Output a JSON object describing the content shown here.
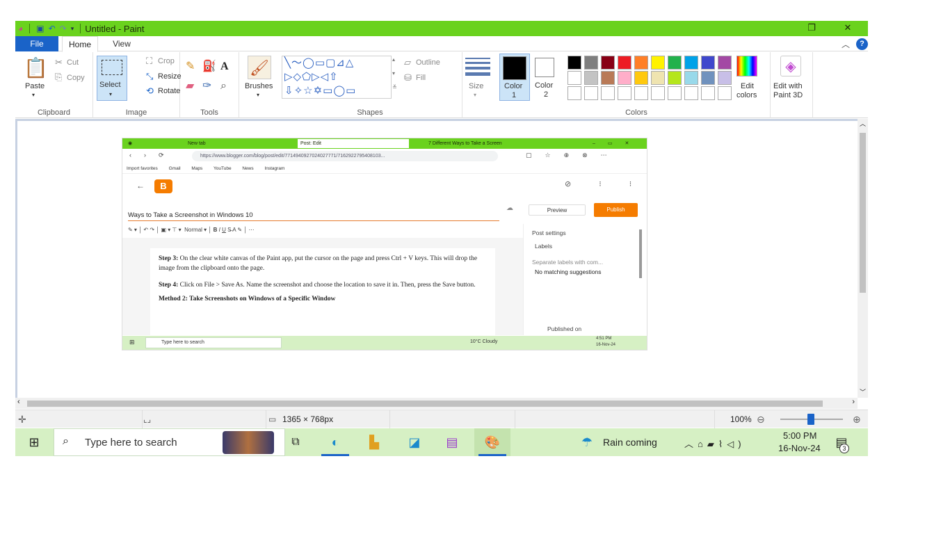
{
  "window": {
    "title": "Untitled - Paint",
    "restore_icon": "restore-icon",
    "close_glyph": "✕",
    "restore_glyph": "❐"
  },
  "tabs": {
    "file": "File",
    "home": "Home",
    "view": "View"
  },
  "ribbon": {
    "clipboard": {
      "group_label": "Clipboard",
      "paste": "Paste",
      "cut": "Cut",
      "copy": "Copy"
    },
    "image": {
      "group_label": "Image",
      "select": "Select",
      "crop": "Crop",
      "resize": "Resize",
      "rotate": "Rotate"
    },
    "tools": {
      "group_label": "Tools"
    },
    "brushes": "Brushes",
    "shapes": {
      "group_label": "Shapes",
      "outline": "Outline",
      "fill": "Fill",
      "glyphs": "╲〜◯▭▢⊿△\n▷◇⬠▷◁⇧\n⇩✧☆✡▭◯▭"
    },
    "size": "Size",
    "colors": {
      "group_label": "Colors",
      "color1": "Color",
      "color1_num": "1",
      "color2": "Color",
      "color2_num": "2",
      "edit_colors": "Edit",
      "edit_colors_2": "colors",
      "edit_3d": "Edit with",
      "edit_3d_2": "Paint 3D",
      "row1": [
        "#000000",
        "#7f7f7f",
        "#880015",
        "#ed1c24",
        "#ff7f27",
        "#fff200",
        "#22b14c",
        "#00a2e8",
        "#3f48cc",
        "#a349a4"
      ],
      "row2": [
        "#ffffff",
        "#c3c3c3",
        "#b97a57",
        "#ffaec9",
        "#ffc90e",
        "#efe4b0",
        "#b5e61d",
        "#99d9ea",
        "#7092be",
        "#c8bfe7"
      ],
      "color1_value": "#000000",
      "color2_value": "#ffffff"
    }
  },
  "status": {
    "canvas_size": "1365 × 768px",
    "zoom": "100%"
  },
  "taskbar": {
    "search_placeholder": "Type here to search",
    "weather": "Rain coming",
    "time": "5:00 PM",
    "date": "16-Nov-24",
    "notifications": "3"
  },
  "screenshot": {
    "tabs": [
      "New tab",
      "Post: Edit",
      "7 Different Ways to Take a Screen"
    ],
    "url": "https://www.blogger.com/blog/post/edit/7714940927024027771/7162922795408103...",
    "bookmarks": [
      "Import favorites",
      "Gmail",
      "Maps",
      "YouTube",
      "News",
      "Instagram"
    ],
    "post_title": "Ways to Take a Screenshot in Windows 10",
    "preview": "Preview",
    "publish": "Publish",
    "toolbar_text": "Normal",
    "step3_label": "Step 3:",
    "step3_text": "On the clear white canvas of the Paint app, put the cursor on the page and press Ctrl + V keys. This will drop the image from the clipboard onto the page.",
    "step4_label": "Step 4:",
    "step4_text": "Click on File > Save As. Name the screenshot and choose the location to save it in. Then, press the Save button.",
    "method2": "Method 2: Take Screenshots on Windows of a Specific Window",
    "side_post_settings": "Post settings",
    "side_labels": "Labels",
    "side_separate": "Separate labels with com...",
    "side_no_match": "No matching suggestions",
    "side_published": "Published on",
    "task_search": "Type here to search",
    "task_weather": "10°C Cloudy",
    "task_time": "4:51 PM",
    "task_date": "16-Nov-24"
  }
}
